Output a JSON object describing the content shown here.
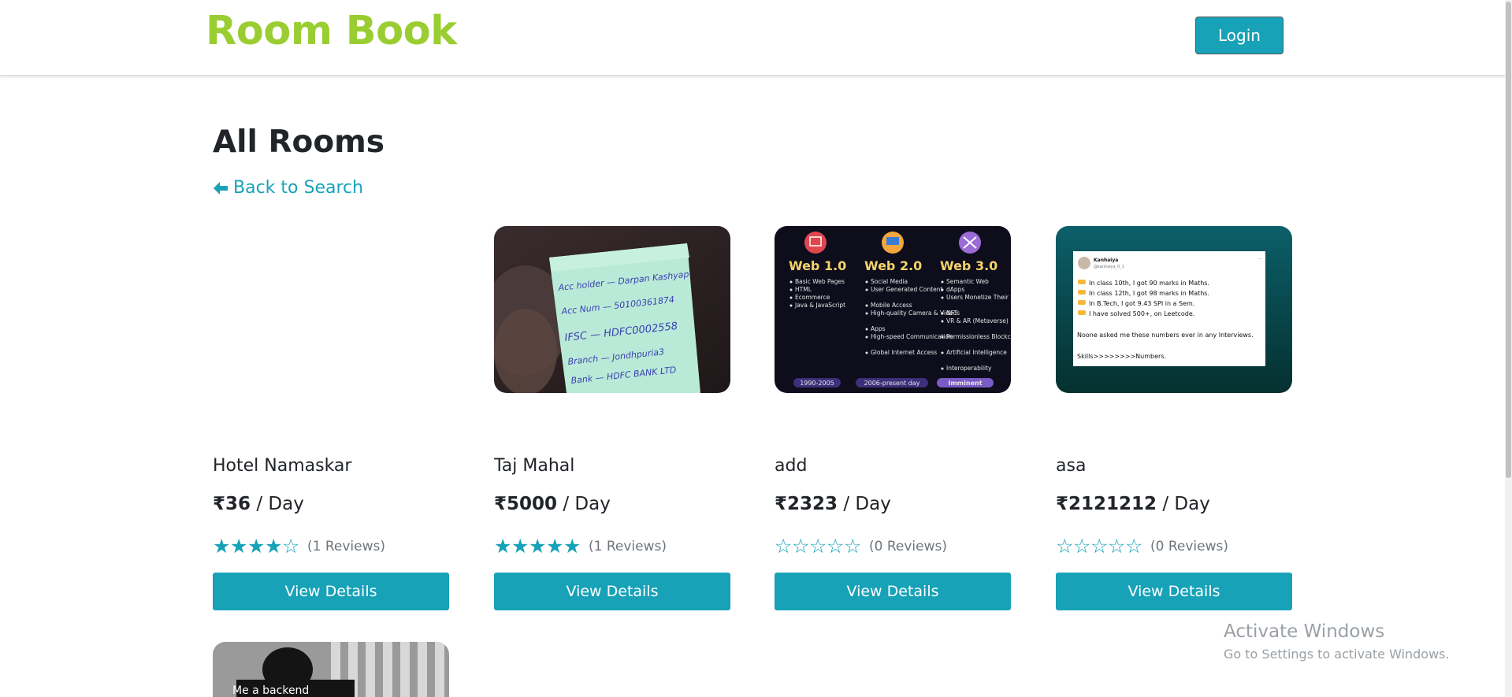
{
  "header": {
    "brand": "Room Book",
    "login_label": "Login"
  },
  "main": {
    "title": "All Rooms",
    "back_link": "Back to Search"
  },
  "rooms": [
    {
      "name": "Hotel Namaskar",
      "price": "₹36",
      "unit": " / Day",
      "stars": [
        "★",
        "★",
        "★",
        "★",
        "☆"
      ],
      "reviews": "(1 Reviews)",
      "button": "View Details"
    },
    {
      "name": "Taj Mahal",
      "price": "₹5000",
      "unit": " / Day",
      "stars": [
        "★",
        "★",
        "★",
        "★",
        "★"
      ],
      "reviews": "(1 Reviews)",
      "button": "View Details",
      "image_text": [
        "Acc holder — Darpan Kashyap",
        "Acc Num — 50100361874",
        "IFSC — HDFC0002558",
        "Branch — Jondhpuria3",
        "Bank — HDFC BANK LTD"
      ]
    },
    {
      "name": "add",
      "price": "₹2323",
      "unit": " / Day",
      "stars": [
        "☆",
        "☆",
        "☆",
        "☆",
        "☆"
      ],
      "reviews": "(0 Reviews)",
      "button": "View Details",
      "image_text": {
        "columns": [
          {
            "title": "Web 1.0",
            "items": [
              "Basic Web Pages",
              "HTML",
              "Ecommerce",
              "Java & JavaScript"
            ],
            "era": "1990-2005"
          },
          {
            "title": "Web 2.0",
            "items": [
              "Social Media",
              "User Generated Content",
              "Mobile Access",
              "High-quality Camera & Video",
              "Apps",
              "High-speed Communication",
              "Global Internet Access"
            ],
            "era": "2006-present day"
          },
          {
            "title": "Web 3.0",
            "items": [
              "Semantic Web",
              "dApps",
              "Users Monetize Their Data",
              "NFTs",
              "VR & AR (Metaverse)",
              "Permissionless Blockchains",
              "Artificial Intelligence",
              "Interoperability"
            ],
            "era": "Imminent"
          }
        ]
      }
    },
    {
      "name": "asa",
      "price": "₹2121212",
      "unit": " / Day",
      "stars": [
        "☆",
        "☆",
        "☆",
        "☆",
        "☆"
      ],
      "reviews": "(0 Reviews)",
      "button": "View Details",
      "image_text": {
        "author": "Kanhaiya",
        "handle": "@kanhaiya_0_1",
        "lines": [
          "In class 10th, I got 90 marks in Maths.",
          "In class 12th, I got 98 marks in Maths.",
          "In B.Tech, I got 9.43 SPI in a Sem.",
          "I have solved 500+, on Leetcode.",
          "Noone asked me these numbers ever in any Interviews.",
          "Skills>>>>>>>>Numbers."
        ]
      }
    }
  ],
  "partial_card": {
    "image_text": "Me a backend"
  },
  "watermark": {
    "line1": "Activate Windows",
    "line2": "Go to Settings to activate Windows."
  },
  "colors": {
    "brand": "#9acd32",
    "accent": "#17a2b8"
  }
}
